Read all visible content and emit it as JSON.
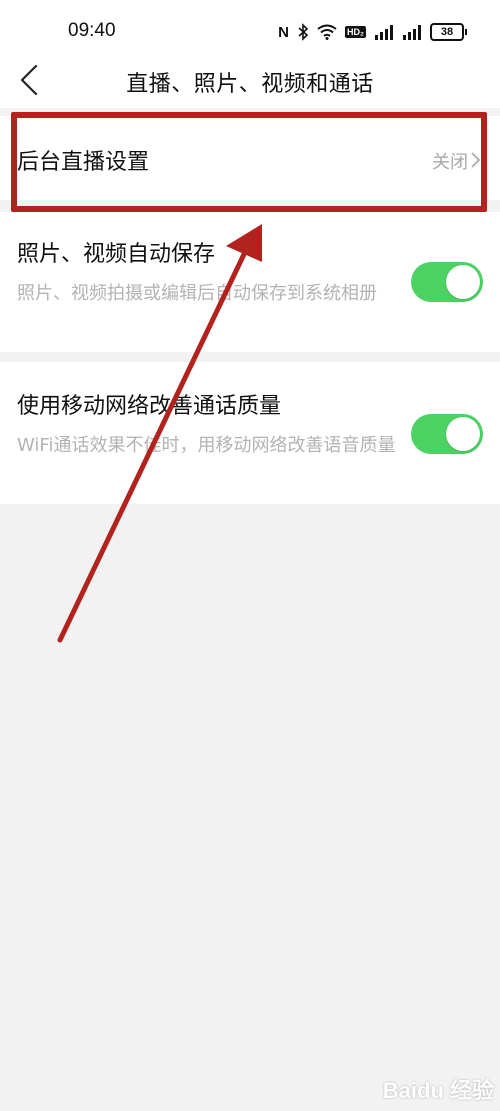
{
  "status_bar": {
    "time": "09:40",
    "icons": [
      "nfc-icon",
      "bluetooth-icon",
      "wifi-icon",
      "hd-icon",
      "signal-icon",
      "signal-icon",
      "battery-icon"
    ],
    "nfc": "N",
    "hd": "HD₂",
    "battery": "38"
  },
  "nav": {
    "title": "直播、照片、视频和通话"
  },
  "settings": {
    "live": {
      "title": "后台直播设置",
      "value": "关闭"
    },
    "autosave": {
      "title": "照片、视频自动保存",
      "subtitle": "照片、视频拍摄或编辑后自动保存到系统相册",
      "enabled": true
    },
    "call_quality": {
      "title": "使用移动网络改善通话质量",
      "subtitle": "WiFi通话效果不佳时，用移动网络改善语音质量",
      "enabled": true
    }
  },
  "colors": {
    "toggle_on": "#4cd263",
    "annotation": "#b3231d",
    "background": "#f2f2f2"
  },
  "watermark": "Baidu 经验"
}
